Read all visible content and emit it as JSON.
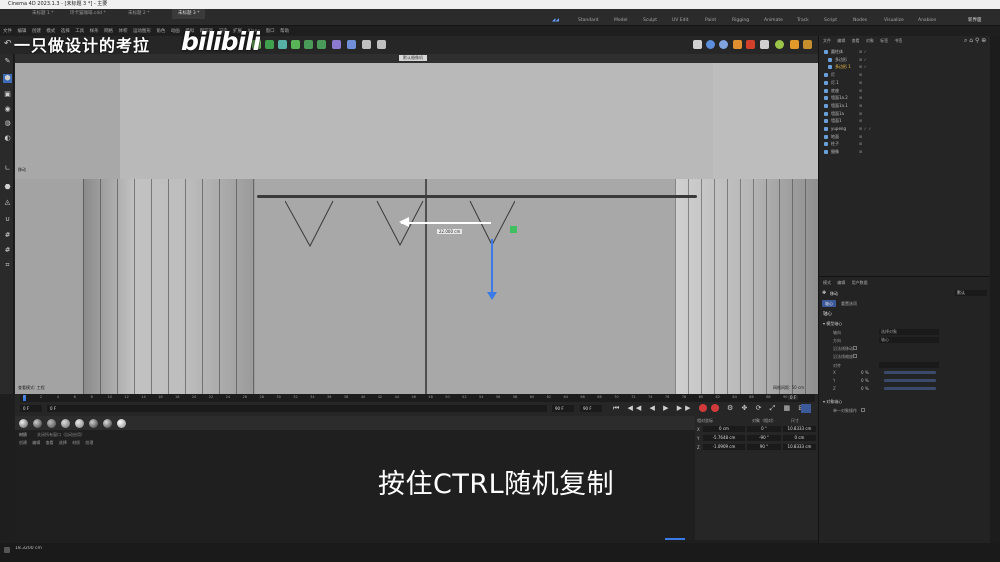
{
  "window_title": "Cinema 4D 2023.1.3 - [未标题 3 *] - 主要",
  "doc_tabs": [
    "未标题 1 *",
    "玲卡猫咖啡.c4d *",
    "未标题 2 *",
    "未标题 3 *"
  ],
  "layout_tabs": [
    "Standard",
    "Model",
    "Sculpt",
    "UV Edit",
    "Paint",
    "Rigging",
    "Animate",
    "Track",
    "Script",
    "Nodes",
    "Visualize",
    "Anabion"
  ],
  "new_interface": "新界面",
  "menu": [
    "文件",
    "编辑",
    "创建",
    "模式",
    "选择",
    "工具",
    "样条",
    "网格",
    "体积",
    "运动图形",
    "角色",
    "动画",
    "模拟",
    "跟踪器",
    "渲染",
    "扩展",
    "Xlane",
    "窗口",
    "帮助"
  ],
  "watermark": "一只做设计的考拉",
  "bili_logo": "bilibili",
  "subtitle": "按住CTRL随机复制",
  "viewport": {
    "label": "默认摄像机",
    "view_name": "透视视图",
    "move_label": "移动",
    "speed_label": "查看模式: 工程",
    "grid_spacing": "网格间距: 50 cm",
    "hud_value": "22.000 cm"
  },
  "timeline": {
    "ticks": [
      "0",
      "2",
      "4",
      "6",
      "8",
      "10",
      "12",
      "14",
      "16",
      "18",
      "20",
      "22",
      "24",
      "26",
      "28",
      "30",
      "32",
      "34",
      "36",
      "38",
      "40",
      "42",
      "44",
      "46",
      "48",
      "50",
      "52",
      "54",
      "56",
      "58",
      "60",
      "62",
      "64",
      "66",
      "68",
      "70",
      "72",
      "74",
      "76",
      "78",
      "80",
      "82",
      "84",
      "86",
      "88",
      "90"
    ],
    "current_frame": "0 F",
    "start": "0 F",
    "field2": "0 F",
    "end": "90 F",
    "end2": "90 F",
    "right_frame": "0 F"
  },
  "materials": {
    "tabs": [
      "材质",
      "关闭所有窗口（自动启用）"
    ],
    "menu": [
      "创建",
      "编辑",
      "查看",
      "选择",
      "材质",
      "纹理"
    ]
  },
  "coords": {
    "headers": [
      "相对坐标",
      "对象（相对）",
      "尺寸"
    ],
    "rows": [
      {
        "axis": "X",
        "pos": "0 cm",
        "rot": "0 °",
        "size": "10.8333 cm"
      },
      {
        "axis": "Y",
        "pos": "-5.7648 cm",
        "rot": "-90 °",
        "size": "0 cm"
      },
      {
        "axis": "Z",
        "pos": "-1.0909 cm",
        "rot": "90 °",
        "size": "10.8333 cm"
      }
    ]
  },
  "object_manager": {
    "menu": [
      "文件",
      "编辑",
      "查看",
      "对象",
      "标签",
      "书签"
    ],
    "objects": [
      {
        "name": "圆柱体",
        "selected": false
      },
      {
        "name": "多边形",
        "selected": false
      },
      {
        "name": "多边形 1",
        "selected": true
      },
      {
        "name": "灯",
        "selected": false
      },
      {
        "name": "灯.1",
        "selected": false
      },
      {
        "name": "底座",
        "selected": false
      },
      {
        "name": "墙面1a.2",
        "selected": false
      },
      {
        "name": "墙面1a.1",
        "selected": false
      },
      {
        "name": "墙面1a",
        "selected": false
      },
      {
        "name": "墙面1",
        "selected": false
      },
      {
        "name": "yupeng",
        "selected": false
      },
      {
        "name": "地面",
        "selected": false
      },
      {
        "name": "柱子",
        "selected": false
      },
      {
        "name": "摄像",
        "selected": false
      }
    ]
  },
  "attributes": {
    "menu": [
      "模式",
      "编辑",
      "用户数据"
    ],
    "tool_name": "移动",
    "dropdown": "默认",
    "tabs": [
      "轴心",
      "重置选项"
    ],
    "section_axis": "轴心",
    "sub_section": "模型轴心",
    "rows": [
      {
        "label": "轴向",
        "value": "选择对象"
      },
      {
        "label": "方向",
        "value": "轴心"
      },
      {
        "label": "沿法线移动",
        "value": ""
      },
      {
        "label": "沿法线缩放",
        "value": ""
      },
      {
        "label": "对齐",
        "value": ""
      }
    ],
    "xyz": [
      {
        "axis": "X",
        "value": "0 %"
      },
      {
        "axis": "Y",
        "value": "0 %"
      },
      {
        "axis": "Z",
        "value": "0 %"
      }
    ],
    "section_reset": "对象轴心",
    "reset_row": "单一对象操作"
  },
  "status_text": "18.3200 cm"
}
